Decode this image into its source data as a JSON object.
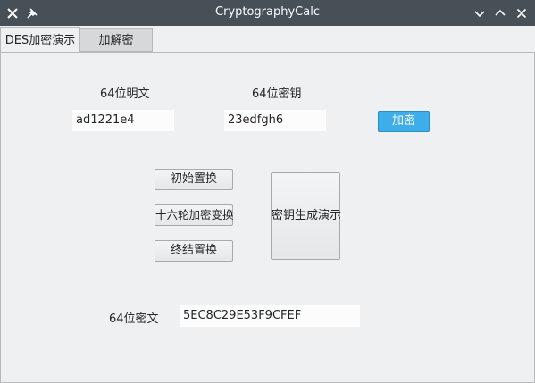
{
  "window": {
    "title": "CryptographyCalc",
    "close_glyph": "✕",
    "pin_glyph": "📌",
    "minimize_glyph": "⌄",
    "maximize_glyph": "⌃",
    "close_right_glyph": "✕"
  },
  "tabs": [
    {
      "label": "DES加密演示",
      "active": true
    },
    {
      "label": "加解密",
      "active": false
    }
  ],
  "plaintext": {
    "label": "64位明文",
    "value": "ad1221e4"
  },
  "key": {
    "label": "64位密钥",
    "value": "23edfgh6"
  },
  "encrypt_button": {
    "label": "加密"
  },
  "steps": {
    "initial_permutation": "初始置换",
    "sixteen_rounds": "十六轮加密变换",
    "final_permutation": "终结置换",
    "key_generation_demo": "密钥生成演示"
  },
  "ciphertext": {
    "label": "64位密文",
    "value": "5EC8C29E53F9CFEF"
  },
  "colors": {
    "titlebar": "#475057",
    "accent": "#3daee9",
    "window_bg": "#eff0f1"
  }
}
